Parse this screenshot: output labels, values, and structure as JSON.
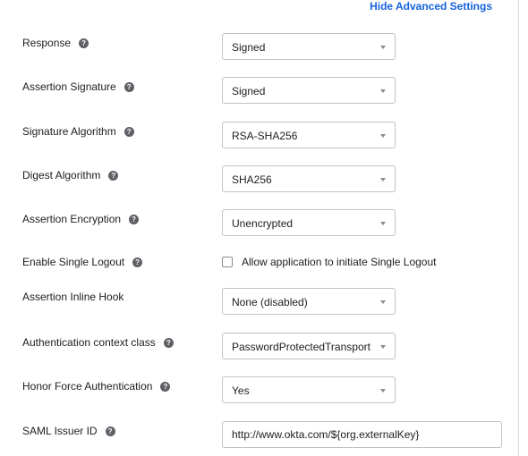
{
  "header": {
    "toggle_label": "Hide Advanced Settings"
  },
  "help_glyph": "?",
  "settings": {
    "response": {
      "label": "Response",
      "value": "Signed"
    },
    "assertion_signature": {
      "label": "Assertion Signature",
      "value": "Signed"
    },
    "signature_algorithm": {
      "label": "Signature Algorithm",
      "value": "RSA-SHA256"
    },
    "digest_algorithm": {
      "label": "Digest Algorithm",
      "value": "SHA256"
    },
    "assertion_encryption": {
      "label": "Assertion Encryption",
      "value": "Unencrypted"
    },
    "single_logout": {
      "label": "Enable Single Logout",
      "checkbox_label": "Allow application to initiate Single Logout",
      "checked": false
    },
    "inline_hook": {
      "label": "Assertion Inline Hook",
      "value": "None (disabled)"
    },
    "auth_context_class": {
      "label": "Authentication context class",
      "value": "PasswordProtectedTransport"
    },
    "honor_force_auth": {
      "label": "Honor Force Authentication",
      "value": "Yes"
    },
    "saml_issuer_id": {
      "label": "SAML Issuer ID",
      "value": "http://www.okta.com/${org.externalKey}"
    }
  },
  "colors": {
    "link": "#1662dd",
    "help_icon": "#5f5f66",
    "border": "#c1c1c8"
  }
}
